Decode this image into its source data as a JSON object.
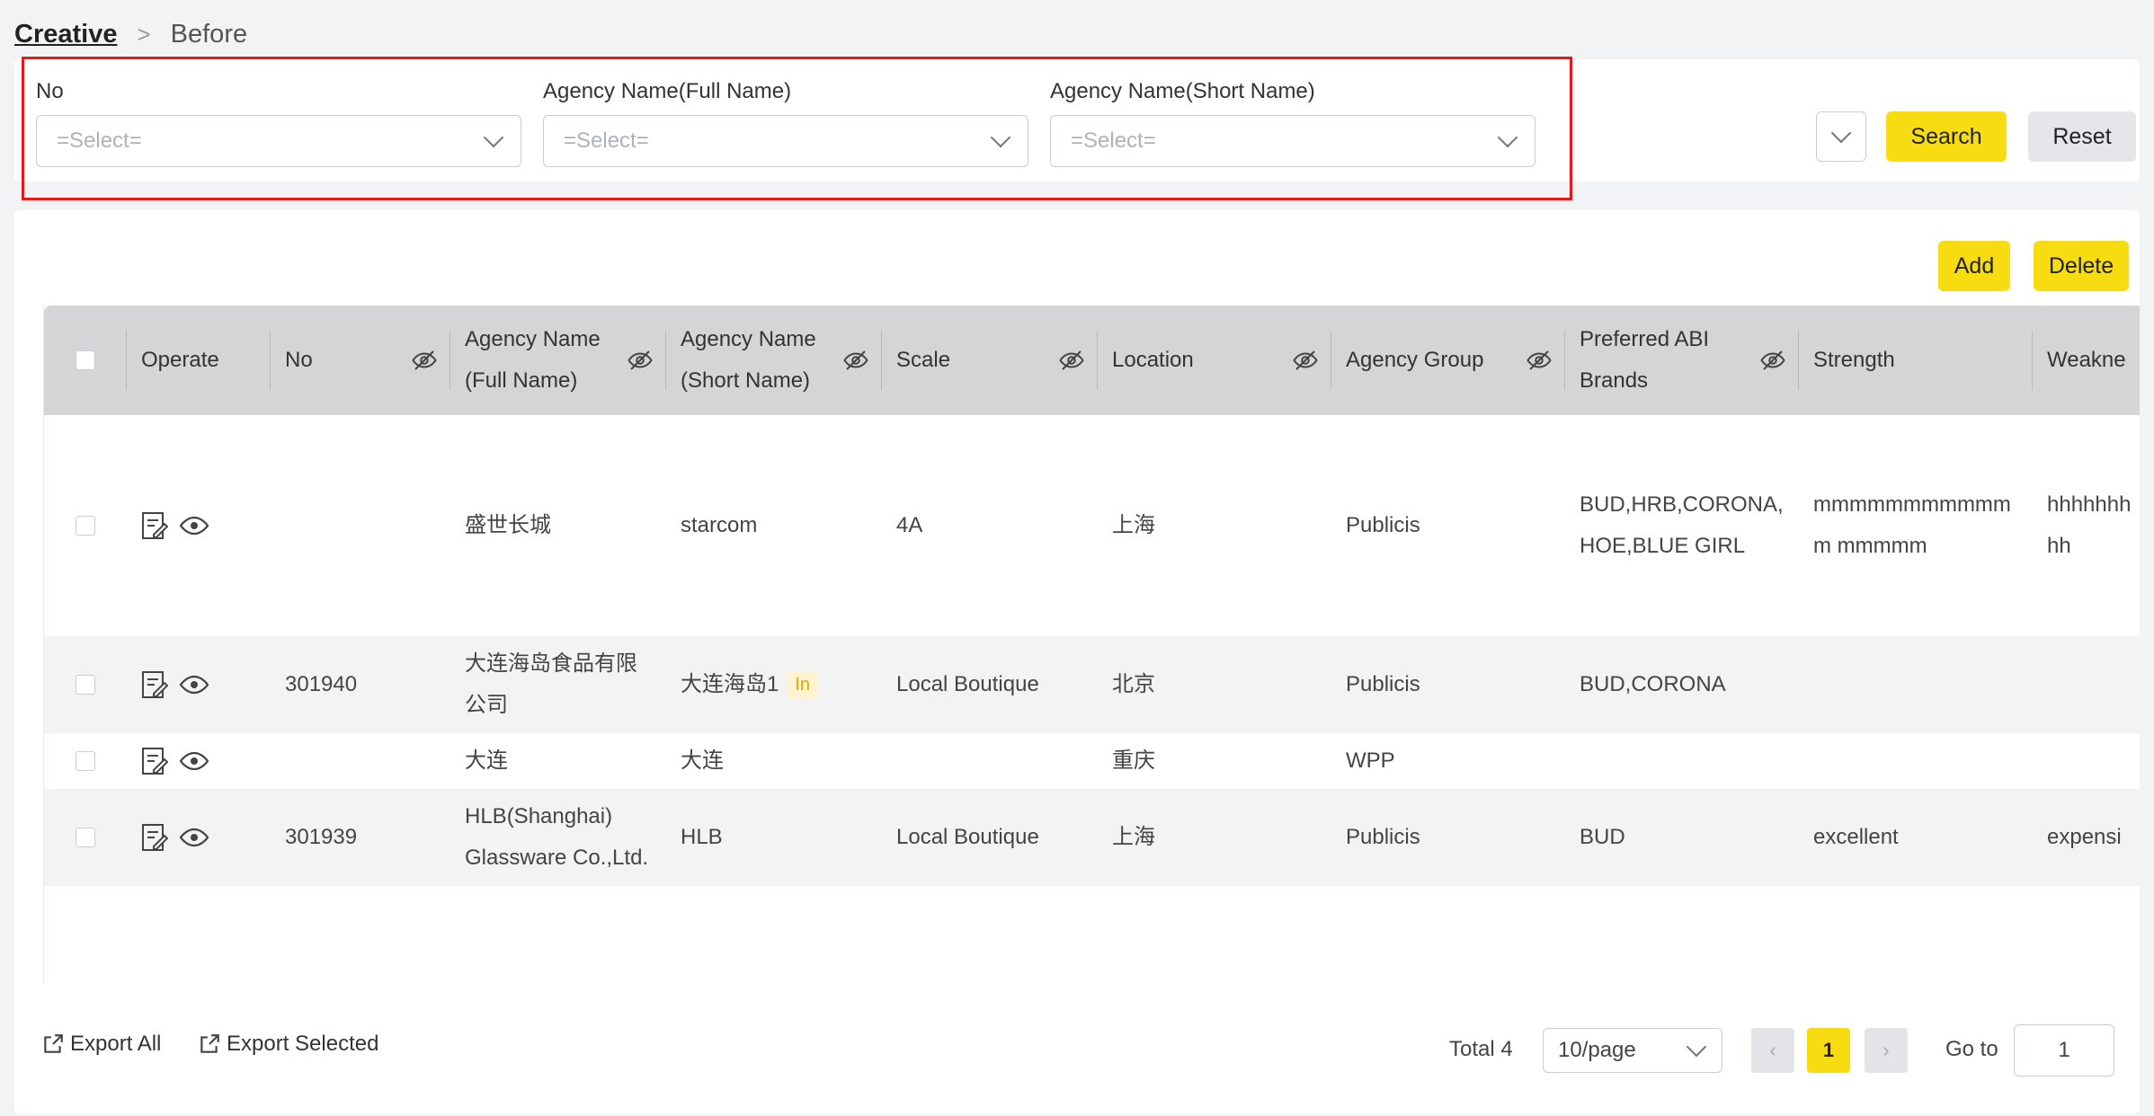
{
  "breadcrumb": {
    "root": "Creative",
    "separator": ">",
    "current": "Before"
  },
  "filters": [
    {
      "label": "No",
      "placeholder": "=Select="
    },
    {
      "label": "Agency Name(Full Name)",
      "placeholder": "=Select="
    },
    {
      "label": "Agency Name(Short Name)",
      "placeholder": "=Select="
    }
  ],
  "actions": {
    "search": "Search",
    "reset": "Reset",
    "add": "Add",
    "delete": "Delete"
  },
  "table": {
    "columns": [
      {
        "label": "Operate",
        "hideable": false
      },
      {
        "label": "No",
        "hideable": true
      },
      {
        "label": "Agency Name (Full Name)",
        "hideable": true
      },
      {
        "label": "Agency Name (Short Name)",
        "hideable": true
      },
      {
        "label": "Scale",
        "hideable": true
      },
      {
        "label": "Location",
        "hideable": true
      },
      {
        "label": "Agency Group",
        "hideable": true
      },
      {
        "label": "Preferred ABI Brands",
        "hideable": true
      },
      {
        "label": "Strength",
        "hideable": false
      },
      {
        "label": "Weakne",
        "hideable": false
      }
    ],
    "rows": [
      {
        "no": "",
        "full_name": "盛世长城",
        "short_name": "starcom",
        "short_tag": "",
        "scale": "4A",
        "location": "上海",
        "group": "Publicis",
        "brands": "BUD,HRB,CORONA, HOE,BLUE GIRL",
        "strength": "mmmmmmmmmmmm mmmmm",
        "weakness": "hhhhhhh hh"
      },
      {
        "no": "301940",
        "full_name": "大连海岛食品有限 公司",
        "short_name": "大连海岛1",
        "short_tag": "In",
        "scale": "Local Boutique",
        "location": "北京",
        "group": "Publicis",
        "brands": "BUD,CORONA",
        "strength": "",
        "weakness": ""
      },
      {
        "no": "",
        "full_name": "大连",
        "short_name": "大连",
        "short_tag": "",
        "scale": "",
        "location": "重庆",
        "group": "WPP",
        "brands": "",
        "strength": "",
        "weakness": ""
      },
      {
        "no": "301939",
        "full_name": "HLB(Shanghai) Glassware Co.,Ltd.",
        "short_name": "HLB",
        "short_tag": "",
        "scale": "Local Boutique",
        "location": "上海",
        "group": "Publicis",
        "brands": "BUD",
        "strength": "excellent",
        "weakness": "expensi"
      }
    ]
  },
  "footer": {
    "export_all": "Export All",
    "export_selected": "Export Selected",
    "total": "Total 4",
    "page_size": "10/page",
    "current_page": "1",
    "goto_label": "Go to",
    "goto_value": "1"
  },
  "colors": {
    "accent": "#f7dc12",
    "highlight_border": "#f01414",
    "header_bg": "#d5d5d7"
  }
}
